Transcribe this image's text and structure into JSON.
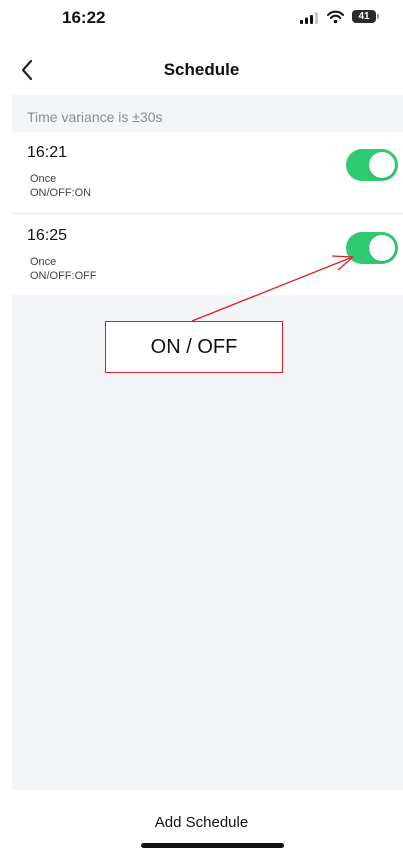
{
  "status_bar": {
    "time": "16:22",
    "battery": "41"
  },
  "nav": {
    "title": "Schedule",
    "back_icon": "chevron-left-icon"
  },
  "schedule": {
    "variance_text": "Time variance is  ±30s",
    "items": [
      {
        "time": "16:21",
        "repeat": "Once",
        "action": "ON/OFF:ON",
        "enabled": true
      },
      {
        "time": "16:25",
        "repeat": "Once",
        "action": "ON/OFF:OFF",
        "enabled": true
      }
    ]
  },
  "annotation": {
    "label": "ON / OFF",
    "color": "#e02020"
  },
  "footer": {
    "add_label": "Add Schedule"
  },
  "colors": {
    "toggle_on": "#2fcb72",
    "background": "#f4f5f9"
  }
}
